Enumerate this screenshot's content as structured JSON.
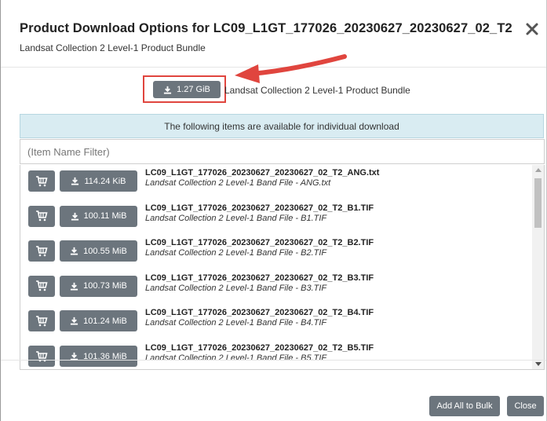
{
  "dialog": {
    "title": "Product Download Options for LC09_L1GT_177026_20230627_20230627_02_T2",
    "subtitle": "Landsat Collection 2 Level-1 Product Bundle",
    "close_icon": "close-icon"
  },
  "bundle": {
    "size": "1.27 GiB",
    "label": "Landsat Collection 2 Level-1 Product Bundle",
    "icon": "download-icon",
    "highlight_color": "#e0453e"
  },
  "info_bar": {
    "text": "The following items are available for individual download"
  },
  "filter": {
    "placeholder": "(Item Name Filter)",
    "value": ""
  },
  "items": [
    {
      "size": "114.24 KiB",
      "name": "LC09_L1GT_177026_20230627_20230627_02_T2_ANG.txt",
      "desc": "Landsat Collection 2 Level-1 Band File - ANG.txt"
    },
    {
      "size": "100.11 MiB",
      "name": "LC09_L1GT_177026_20230627_20230627_02_T2_B1.TIF",
      "desc": "Landsat Collection 2 Level-1 Band File - B1.TIF"
    },
    {
      "size": "100.55 MiB",
      "name": "LC09_L1GT_177026_20230627_20230627_02_T2_B2.TIF",
      "desc": "Landsat Collection 2 Level-1 Band File - B2.TIF"
    },
    {
      "size": "100.73 MiB",
      "name": "LC09_L1GT_177026_20230627_20230627_02_T2_B3.TIF",
      "desc": "Landsat Collection 2 Level-1 Band File - B3.TIF"
    },
    {
      "size": "101.24 MiB",
      "name": "LC09_L1GT_177026_20230627_20230627_02_T2_B4.TIF",
      "desc": "Landsat Collection 2 Level-1 Band File - B4.TIF"
    },
    {
      "size": "101.36 MiB",
      "name": "LC09_L1GT_177026_20230627_20230627_02_T2_B5.TIF",
      "desc": "Landsat Collection 2 Level-1 Band File - B5.TIF"
    }
  ],
  "footer": {
    "add_all_label": "Add All to Bulk",
    "close_label": "Close"
  },
  "colors": {
    "button": "#6c757d",
    "info_bar": "#d9ecf2",
    "arrow": "#e0453e"
  }
}
